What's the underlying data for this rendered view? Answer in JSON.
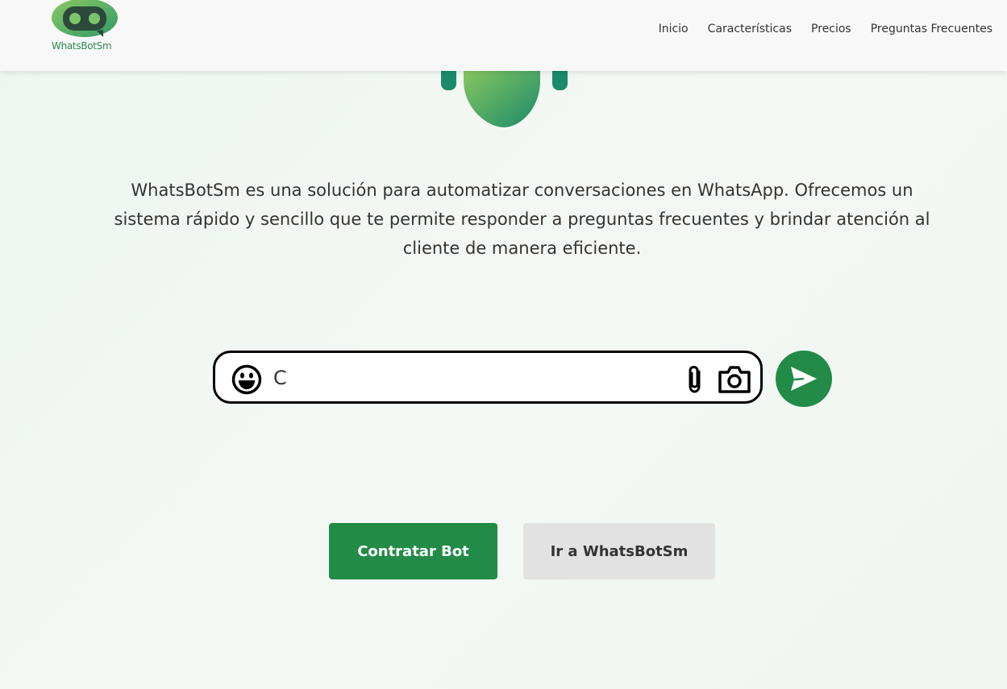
{
  "brand": {
    "name": "WhatsBotSm",
    "accent": "#228b47"
  },
  "nav": {
    "items": [
      {
        "label": "Inicio"
      },
      {
        "label": "Características"
      },
      {
        "label": "Precios"
      },
      {
        "label": "Preguntas Frecuentes"
      }
    ]
  },
  "hero": {
    "description": "WhatsBotSm es una solución para automatizar conversaciones en WhatsApp. Ofrecemos un sistema rápido y sencillo que te permite responder a preguntas frecuentes y brindar atención al cliente de manera eficiente."
  },
  "chat": {
    "input_value": "C",
    "emoji_icon": "smiley-icon",
    "attach_icon": "paperclip-icon",
    "camera_icon": "camera-icon",
    "send_icon": "send-icon"
  },
  "actions": {
    "primary_label": "Contratar Bot",
    "secondary_label": "Ir a WhatsBotSm"
  }
}
